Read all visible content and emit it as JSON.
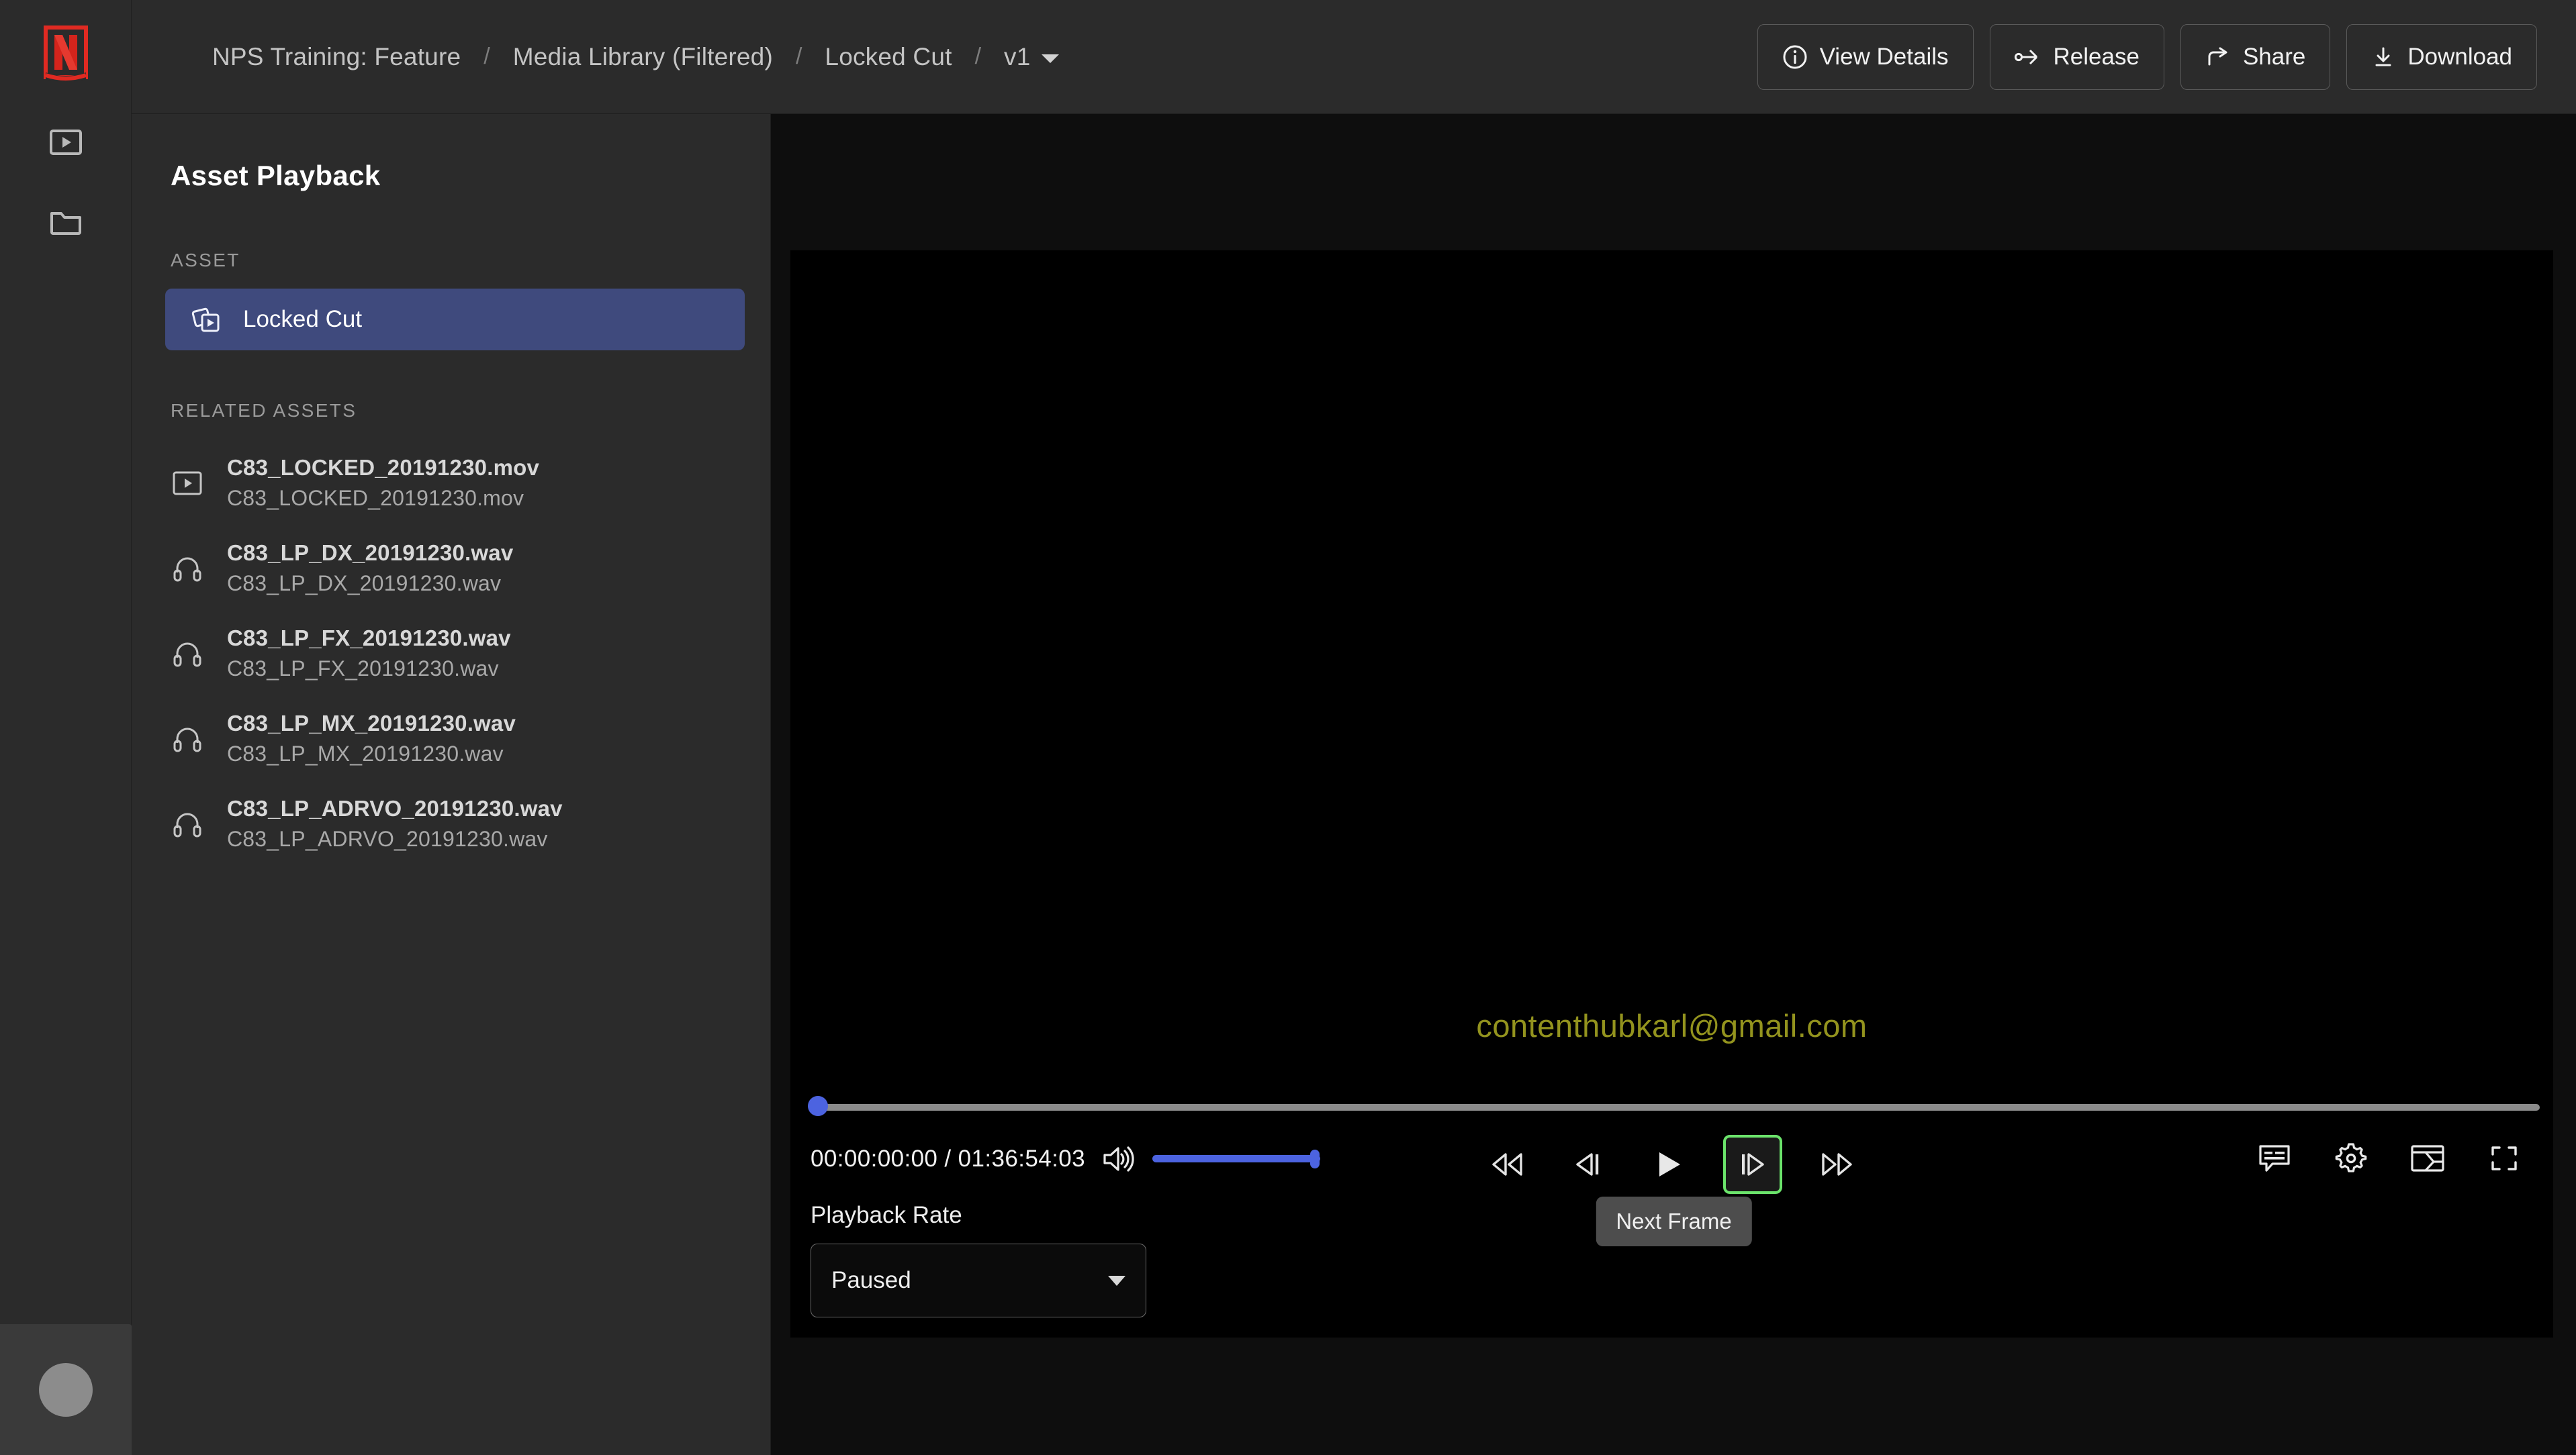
{
  "brand": {
    "logo_name": "netflix-logo",
    "logo_color": "#e02a22"
  },
  "rail": {
    "items": [
      {
        "icon": "video-library-icon",
        "name": "rail-item-video-library"
      },
      {
        "icon": "folder-icon",
        "name": "rail-item-folders"
      }
    ],
    "avatar_name": "user-avatar"
  },
  "breadcrumb": {
    "items": [
      {
        "label": "NPS Training: Feature"
      },
      {
        "label": "Media Library (Filtered)"
      },
      {
        "label": "Locked Cut"
      }
    ],
    "separator": "/",
    "version": "v1"
  },
  "toolbar": {
    "view_details_label": "View Details",
    "release_label": "Release",
    "share_label": "Share",
    "download_label": "Download"
  },
  "sidebar": {
    "title": "Asset Playback",
    "asset_section_label": "ASSET",
    "related_section_label": "RELATED ASSETS",
    "selected_asset": {
      "label": "Locked Cut",
      "icon": "media-stack-play-icon"
    },
    "related_assets": [
      {
        "name": "C83_LOCKED_20191230.mov",
        "sub": "C83_LOCKED_20191230.mov",
        "icon": "video-file-icon"
      },
      {
        "name": "C83_LP_DX_20191230.wav",
        "sub": "C83_LP_DX_20191230.wav",
        "icon": "headphones-icon"
      },
      {
        "name": "C83_LP_FX_20191230.wav",
        "sub": "C83_LP_FX_20191230.wav",
        "icon": "headphones-icon"
      },
      {
        "name": "C83_LP_MX_20191230.wav",
        "sub": "C83_LP_MX_20191230.wav",
        "icon": "headphones-icon"
      },
      {
        "name": "C83_LP_ADRVO_20191230.wav",
        "sub": "C83_LP_ADRVO_20191230.wav",
        "icon": "headphones-icon"
      }
    ]
  },
  "player": {
    "watermark": "contenthubkarl@gmail.com",
    "watermark_color": "#93931e",
    "current_time": "00:00:00:00",
    "duration": "01:36:54:03",
    "timecode_display": "00:00:00:00 / 01:36:54:03",
    "seek_progress_percent": 0,
    "volume_percent": 100,
    "accent_color": "#4c63e0",
    "focus_ring_color": "#6be36b",
    "transport": [
      {
        "label": "Rewind",
        "icon": "rewind-icon",
        "focused": false
      },
      {
        "label": "Previous Frame",
        "icon": "previous-frame-icon",
        "focused": false
      },
      {
        "label": "Play",
        "icon": "play-icon",
        "focused": false
      },
      {
        "label": "Next Frame",
        "icon": "next-frame-icon",
        "focused": true
      },
      {
        "label": "Fast Forward",
        "icon": "fast-forward-icon",
        "focused": false
      }
    ],
    "tooltip": "Next Frame",
    "right_icons": [
      {
        "label": "Subtitles",
        "icon": "subtitles-icon"
      },
      {
        "label": "Settings",
        "icon": "gear-icon"
      },
      {
        "label": "Layout",
        "icon": "layout-panel-icon"
      },
      {
        "label": "Fullscreen",
        "icon": "fullscreen-icon"
      }
    ],
    "playback_rate_label": "Playback Rate",
    "playback_rate_value": "Paused"
  }
}
